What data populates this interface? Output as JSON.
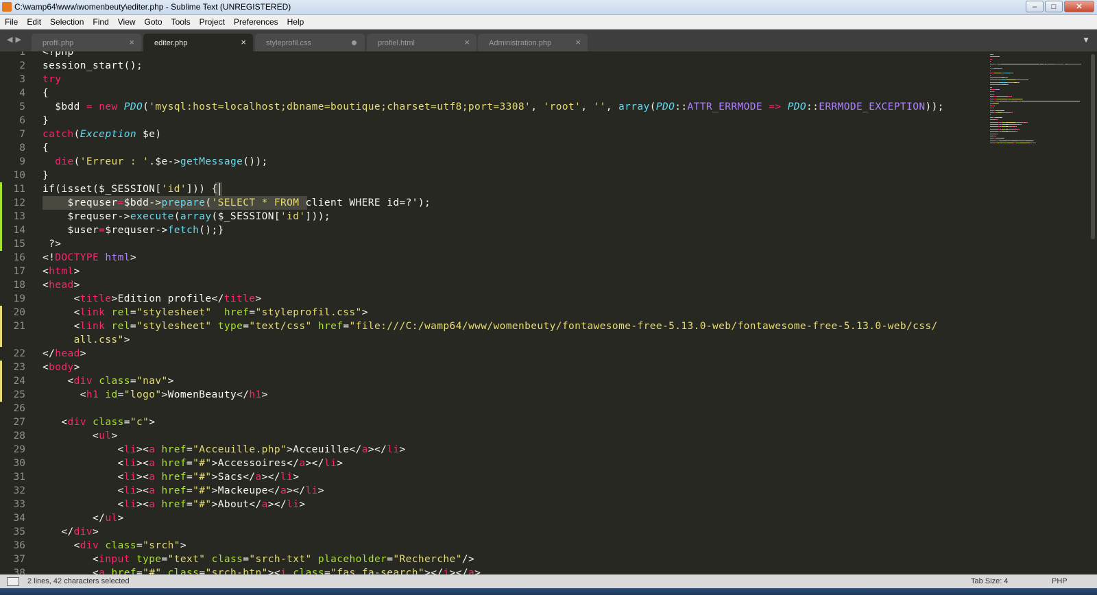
{
  "window": {
    "title": "C:\\wamp64\\www\\womenbeuty\\editer.php - Sublime Text (UNREGISTERED)"
  },
  "menu": [
    "File",
    "Edit",
    "Selection",
    "Find",
    "View",
    "Goto",
    "Tools",
    "Project",
    "Preferences",
    "Help"
  ],
  "tabs": [
    {
      "label": "profil.php",
      "active": false,
      "modified": false
    },
    {
      "label": "editer.php",
      "active": true,
      "modified": false
    },
    {
      "label": "styleprofil.css",
      "active": false,
      "modified": true
    },
    {
      "label": "profiel.html",
      "active": false,
      "modified": false
    },
    {
      "label": "Administration.php",
      "active": false,
      "modified": false
    }
  ],
  "colors": {
    "editor_bg": "#272822",
    "keyword": "#f92672",
    "string": "#e6db74",
    "function": "#66d9ef",
    "constant": "#ae81ff",
    "tag": "#f92672",
    "default": "#f8f8f2"
  },
  "gutter": [
    "1",
    "2",
    "3",
    "4",
    "5",
    "6",
    "7",
    "8",
    "9",
    "10",
    "11",
    "12",
    "13",
    "14",
    "15",
    "16",
    "17",
    "18",
    "19",
    "20",
    "21",
    "22",
    "23",
    "24",
    "25",
    "26",
    "27",
    "28",
    "29",
    "30",
    "31",
    "32",
    "33",
    "34",
    "35",
    "36",
    "37",
    "38"
  ],
  "code": [
    [
      [
        "<?php",
        ""
      ]
    ],
    [
      [
        "session_start();",
        ""
      ]
    ],
    [
      [
        "try",
        "k"
      ]
    ],
    [
      [
        "{",
        ""
      ]
    ],
    [
      [
        "  $bdd ",
        ""
      ],
      [
        "=",
        "o"
      ],
      [
        " ",
        ""
      ],
      [
        "new",
        "k"
      ],
      [
        " ",
        ""
      ],
      [
        "PDO",
        "i"
      ],
      [
        "(",
        ""
      ],
      [
        "'mysql:host=localhost;dbname=boutique;charset=utf8;port=3308'",
        "s"
      ],
      [
        ", ",
        ""
      ],
      [
        "'root'",
        "s"
      ],
      [
        ", ",
        ""
      ],
      [
        "''",
        "s"
      ],
      [
        ", ",
        ""
      ],
      [
        "array",
        "f"
      ],
      [
        "(",
        ""
      ],
      [
        "PDO",
        "i"
      ],
      [
        "::",
        ""
      ],
      [
        "ATTR_ERRMODE",
        "c"
      ],
      [
        " ",
        ""
      ],
      [
        "=>",
        "o"
      ],
      [
        " ",
        ""
      ],
      [
        "PDO",
        "i"
      ],
      [
        "::",
        ""
      ],
      [
        "ERRMODE_EXCEPTION",
        "c"
      ],
      [
        "));",
        ""
      ]
    ],
    [
      [
        "}",
        ""
      ]
    ],
    [
      [
        "catch",
        "k"
      ],
      [
        "(",
        ""
      ],
      [
        "Exception",
        "i"
      ],
      [
        " $e)",
        ""
      ]
    ],
    [
      [
        "{",
        ""
      ]
    ],
    [
      [
        "  ",
        ""
      ],
      [
        "die",
        "k"
      ],
      [
        "(",
        ""
      ],
      [
        "'Erreur : '",
        "s"
      ],
      [
        ".",
        ""
      ],
      [
        "$e->",
        ""
      ],
      [
        "getMessage",
        "f"
      ],
      [
        "());",
        ""
      ]
    ],
    [
      [
        "}",
        ""
      ]
    ],
    [
      [
        "if(isset($_SESSION[",
        ""
      ],
      [
        "'id'",
        "s"
      ],
      [
        "])) {",
        ""
      ]
    ],
    [
      [
        "    $requser",
        ""
      ],
      [
        "=",
        "o"
      ],
      [
        "$bdd->",
        ""
      ],
      [
        "prepare",
        "f"
      ],
      [
        "(",
        ""
      ],
      [
        "'SELECT * FROM",
        "s"
      ],
      [
        " client WHERE id=?'",
        ""
      ],
      [
        ");",
        ""
      ]
    ],
    [
      [
        "    $requser->",
        ""
      ],
      [
        "execute",
        "f"
      ],
      [
        "(",
        ""
      ],
      [
        "array",
        "f"
      ],
      [
        "($_SESSION[",
        ""
      ],
      [
        "'id'",
        "s"
      ],
      [
        "]));",
        ""
      ]
    ],
    [
      [
        "    $user",
        ""
      ],
      [
        "=",
        "o"
      ],
      [
        "$requser->",
        ""
      ],
      [
        "fetch",
        "f"
      ],
      [
        "();}",
        ""
      ]
    ],
    [
      [
        " ?>",
        ""
      ]
    ],
    [
      [
        "<!",
        ""
      ],
      [
        "DOCTYPE",
        "k"
      ],
      [
        " ",
        ""
      ],
      [
        "html",
        "c"
      ],
      [
        ">",
        ""
      ]
    ],
    [
      [
        "<",
        ""
      ],
      [
        "html",
        "k"
      ],
      [
        ">",
        ""
      ]
    ],
    [
      [
        "<",
        ""
      ],
      [
        "head",
        "k"
      ],
      [
        ">",
        ""
      ]
    ],
    [
      [
        "     <",
        ""
      ],
      [
        "title",
        "k"
      ],
      [
        ">Edition profile</",
        ""
      ],
      [
        "title",
        "k"
      ],
      [
        ">",
        ""
      ]
    ],
    [
      [
        "     <",
        ""
      ],
      [
        "link",
        "k"
      ],
      [
        " ",
        ""
      ],
      [
        "rel",
        "g"
      ],
      [
        "=",
        ""
      ],
      [
        "\"stylesheet\"",
        "s"
      ],
      [
        "  ",
        ""
      ],
      [
        "href",
        "g"
      ],
      [
        "=",
        ""
      ],
      [
        "\"styleprofil.css\"",
        "s"
      ],
      [
        ">",
        ""
      ]
    ],
    [
      [
        "     <",
        ""
      ],
      [
        "link",
        "k"
      ],
      [
        " ",
        ""
      ],
      [
        "rel",
        "g"
      ],
      [
        "=",
        ""
      ],
      [
        "\"stylesheet\"",
        "s"
      ],
      [
        " ",
        ""
      ],
      [
        "type",
        "g"
      ],
      [
        "=",
        ""
      ],
      [
        "\"text/css\"",
        "s"
      ],
      [
        " ",
        ""
      ],
      [
        "href",
        "g"
      ],
      [
        "=",
        ""
      ],
      [
        "\"file:///C:/wamp64/www/womenbeuty/fontawesome-free-5.13.0-web/fontawesome-free-5.13.0-web/css/",
        "s"
      ]
    ],
    [
      [
        "     ",
        ""
      ],
      [
        "all.css\"",
        "s"
      ],
      [
        ">",
        ""
      ]
    ],
    [
      [
        "</",
        ""
      ],
      [
        "head",
        "k"
      ],
      [
        ">",
        ""
      ]
    ],
    [
      [
        "<",
        ""
      ],
      [
        "body",
        "k"
      ],
      [
        ">",
        ""
      ]
    ],
    [
      [
        "    <",
        ""
      ],
      [
        "div",
        "k"
      ],
      [
        " ",
        ""
      ],
      [
        "class",
        "g"
      ],
      [
        "=",
        ""
      ],
      [
        "\"nav\"",
        "s"
      ],
      [
        ">",
        ""
      ]
    ],
    [
      [
        "      <",
        ""
      ],
      [
        "h1",
        "k"
      ],
      [
        " ",
        ""
      ],
      [
        "id",
        "g"
      ],
      [
        "=",
        ""
      ],
      [
        "\"logo\"",
        "s"
      ],
      [
        ">WomenBeauty</",
        ""
      ],
      [
        "h1",
        "k"
      ],
      [
        ">",
        ""
      ]
    ],
    [
      [
        "",
        ""
      ]
    ],
    [
      [
        "   <",
        ""
      ],
      [
        "div",
        "k"
      ],
      [
        " ",
        ""
      ],
      [
        "class",
        "g"
      ],
      [
        "=",
        ""
      ],
      [
        "\"c\"",
        "s"
      ],
      [
        ">",
        ""
      ]
    ],
    [
      [
        "        <",
        ""
      ],
      [
        "ul",
        "k"
      ],
      [
        ">",
        ""
      ]
    ],
    [
      [
        "            <",
        ""
      ],
      [
        "li",
        "k"
      ],
      [
        "><",
        ""
      ],
      [
        "a",
        "k"
      ],
      [
        " ",
        ""
      ],
      [
        "href",
        "g"
      ],
      [
        "=",
        ""
      ],
      [
        "\"Acceuille.php\"",
        "s"
      ],
      [
        ">Acceuille</",
        ""
      ],
      [
        "a",
        "k"
      ],
      [
        "></",
        ""
      ],
      [
        "li",
        "k"
      ],
      [
        ">",
        ""
      ]
    ],
    [
      [
        "            <",
        ""
      ],
      [
        "li",
        "k"
      ],
      [
        "><",
        ""
      ],
      [
        "a",
        "k"
      ],
      [
        " ",
        ""
      ],
      [
        "href",
        "g"
      ],
      [
        "=",
        ""
      ],
      [
        "\"#\"",
        "s"
      ],
      [
        ">Accessoires</",
        ""
      ],
      [
        "a",
        "k"
      ],
      [
        "></",
        ""
      ],
      [
        "li",
        "k"
      ],
      [
        ">",
        ""
      ]
    ],
    [
      [
        "            <",
        ""
      ],
      [
        "li",
        "k"
      ],
      [
        "><",
        ""
      ],
      [
        "a",
        "k"
      ],
      [
        " ",
        ""
      ],
      [
        "href",
        "g"
      ],
      [
        "=",
        ""
      ],
      [
        "\"#\"",
        "s"
      ],
      [
        ">Sacs</",
        ""
      ],
      [
        "a",
        "k"
      ],
      [
        "></",
        ""
      ],
      [
        "li",
        "k"
      ],
      [
        ">",
        ""
      ]
    ],
    [
      [
        "            <",
        ""
      ],
      [
        "li",
        "k"
      ],
      [
        "><",
        ""
      ],
      [
        "a",
        "k"
      ],
      [
        " ",
        ""
      ],
      [
        "href",
        "g"
      ],
      [
        "=",
        ""
      ],
      [
        "\"#\"",
        "s"
      ],
      [
        ">Mackeupe</",
        ""
      ],
      [
        "a",
        "k"
      ],
      [
        "></",
        ""
      ],
      [
        "li",
        "k"
      ],
      [
        ">",
        ""
      ]
    ],
    [
      [
        "            <",
        ""
      ],
      [
        "li",
        "k"
      ],
      [
        "><",
        ""
      ],
      [
        "a",
        "k"
      ],
      [
        " ",
        ""
      ],
      [
        "href",
        "g"
      ],
      [
        "=",
        ""
      ],
      [
        "\"#\"",
        "s"
      ],
      [
        ">About</",
        ""
      ],
      [
        "a",
        "k"
      ],
      [
        "></",
        ""
      ],
      [
        "li",
        "k"
      ],
      [
        ">",
        ""
      ]
    ],
    [
      [
        "        </",
        ""
      ],
      [
        "ul",
        "k"
      ],
      [
        ">",
        ""
      ]
    ],
    [
      [
        "   </",
        ""
      ],
      [
        "div",
        "k"
      ],
      [
        ">",
        ""
      ]
    ],
    [
      [
        "     <",
        ""
      ],
      [
        "div",
        "k"
      ],
      [
        " ",
        ""
      ],
      [
        "class",
        "g"
      ],
      [
        "=",
        ""
      ],
      [
        "\"srch\"",
        "s"
      ],
      [
        ">",
        ""
      ]
    ],
    [
      [
        "        <",
        ""
      ],
      [
        "input",
        "k"
      ],
      [
        " ",
        ""
      ],
      [
        "type",
        "g"
      ],
      [
        "=",
        ""
      ],
      [
        "\"text\"",
        "s"
      ],
      [
        " ",
        ""
      ],
      [
        "class",
        "g"
      ],
      [
        "=",
        ""
      ],
      [
        "\"srch-txt\"",
        "s"
      ],
      [
        " ",
        ""
      ],
      [
        "placeholder",
        "g"
      ],
      [
        "=",
        ""
      ],
      [
        "\"Recherche\"",
        "s"
      ],
      [
        "/>",
        ""
      ]
    ],
    [
      [
        "        <",
        ""
      ],
      [
        "a",
        "k"
      ],
      [
        " ",
        ""
      ],
      [
        "href",
        "g"
      ],
      [
        "=",
        ""
      ],
      [
        "\"#\"",
        "s"
      ],
      [
        " ",
        ""
      ],
      [
        "class",
        "g"
      ],
      [
        "=",
        ""
      ],
      [
        "\"srch-btn\"",
        "s"
      ],
      [
        "><",
        ""
      ],
      [
        "i",
        "k"
      ],
      [
        " ",
        ""
      ],
      [
        "class",
        "g"
      ],
      [
        "=",
        ""
      ],
      [
        "\"fas fa-search\"",
        "s"
      ],
      [
        "></",
        ""
      ],
      [
        "i",
        "k"
      ],
      [
        "></",
        ""
      ],
      [
        "a",
        "k"
      ],
      [
        ">",
        ""
      ]
    ]
  ],
  "status": {
    "selection": "2 lines, 42 characters selected",
    "tab_size": "Tab Size: 4",
    "syntax": "PHP"
  }
}
